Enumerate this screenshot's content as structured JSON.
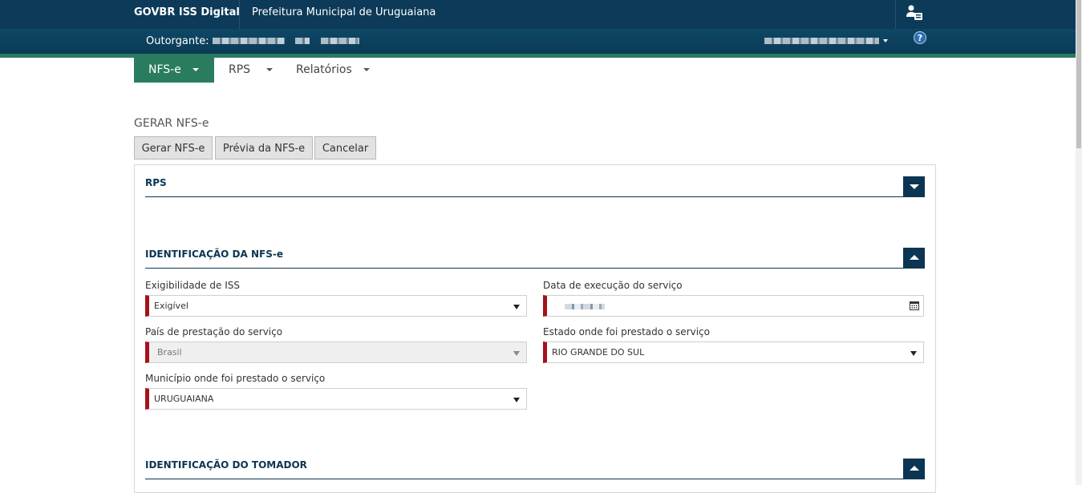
{
  "header": {
    "brand": "GOVBR ISS Digital",
    "municipio": "Prefeitura Municipal de Uruguaiana",
    "outorgante_label": "Outorgante:",
    "help": "?"
  },
  "menu": [
    {
      "label": "NFS-e"
    },
    {
      "label": "RPS"
    },
    {
      "label": "Relatórios"
    }
  ],
  "page": {
    "title": "GERAR NFS-e",
    "buttons": {
      "gerar": "Gerar NFS-e",
      "previa": "Prévia da NFS-e",
      "cancelar": "Cancelar"
    }
  },
  "sections": {
    "rps": "RPS",
    "identificacao_nfse": "IDENTIFICAÇÃO DA NFS-e",
    "identificacao_tomador": "IDENTIFICAÇÃO DO TOMADOR"
  },
  "form": {
    "exigibilidade": {
      "label": "Exigibilidade de ISS",
      "value": "Exigível"
    },
    "data_execucao": {
      "label": "Data de execução do serviço"
    },
    "pais": {
      "label": "País de prestação do serviço",
      "value": "Brasil"
    },
    "estado": {
      "label": "Estado onde foi prestado o serviço",
      "value": "RIO GRANDE DO SUL"
    },
    "municipio": {
      "label": "Município onde foi prestado o serviço",
      "value": "URUGUAIANA"
    }
  },
  "icons": {
    "user": "user-card-icon",
    "calendar": "calendar-icon"
  },
  "colors": {
    "navy": "#0c3a58",
    "green": "#2a7c5e",
    "required": "#a5121a"
  }
}
